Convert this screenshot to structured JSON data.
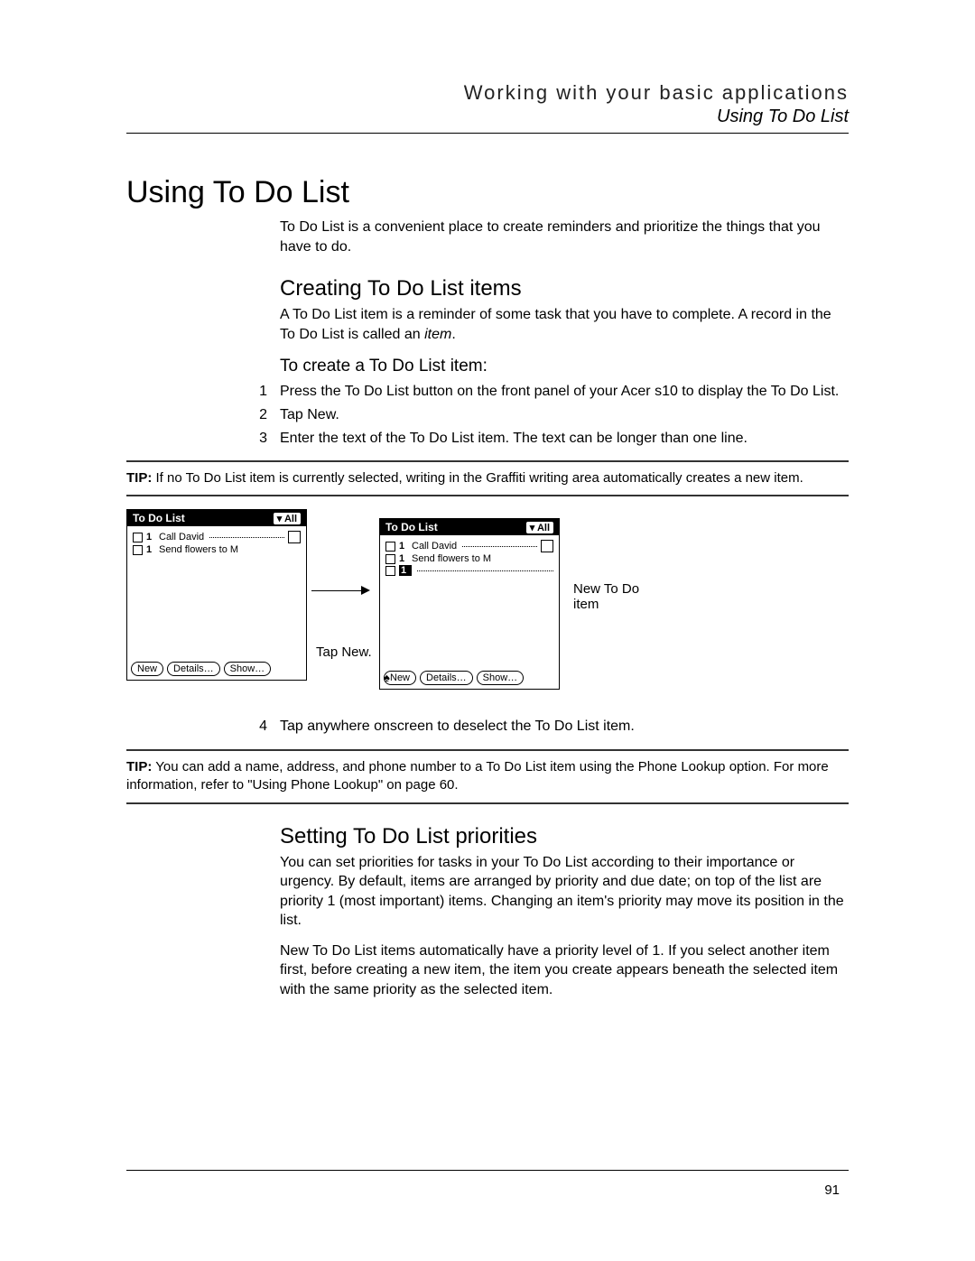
{
  "header": {
    "chapter": "Working with your basic applications",
    "subsection": "Using To Do List"
  },
  "h1": "Using To Do List",
  "intro": "To Do List is a convenient place to create reminders and prioritize the things that you have to do.",
  "h2a": "Creating To Do List items",
  "p2": "A To Do List item is a reminder of some task that you have to complete. A record in the To Do List is called an ",
  "p2_em": "item",
  "p2_end": ".",
  "h3a": "To create a To Do List item:",
  "steps": {
    "s1": {
      "n": "1",
      "t": "Press the To Do List button on the front panel of your Acer s10 to display the To Do List."
    },
    "s2": {
      "n": "2",
      "t": "Tap New."
    },
    "s3": {
      "n": "3",
      "t": "Enter the text of the To Do List item. The text can be longer than one line."
    },
    "s4": {
      "n": "4",
      "t": "Tap anywhere onscreen to deselect the To Do List item."
    }
  },
  "tip1": "If no To Do List item is currently selected, writing in the Graffiti writing area automatically creates a new item.",
  "tip_label": "TIP:",
  "tip2": "You can add a name, address, and phone number to a To Do List item using the Phone Lookup option. For more information, refer to \"Using Phone Lookup\" on page 60.",
  "h2b": "Setting To Do List priorities",
  "p3": "You can set priorities for tasks in your To Do List according to their importance or urgency. By default, items are arranged by priority and due date; on top of the list are priority 1 (most important) items. Changing an item's priority may move its position in the list.",
  "p4": "New To Do List items automatically have a priority level of 1. If you select another item first, before creating a new item, the item you create appears beneath the selected item with the same priority as the selected item.",
  "page_num": "91",
  "palm": {
    "title": "To Do List",
    "category": "All",
    "item1": "Call David",
    "item2": "Send flowers to M",
    "btn_new": "New",
    "btn_details": "Details…",
    "btn_show": "Show…"
  },
  "call_tapnew": "Tap New.",
  "call_newitem": "New To Do item"
}
